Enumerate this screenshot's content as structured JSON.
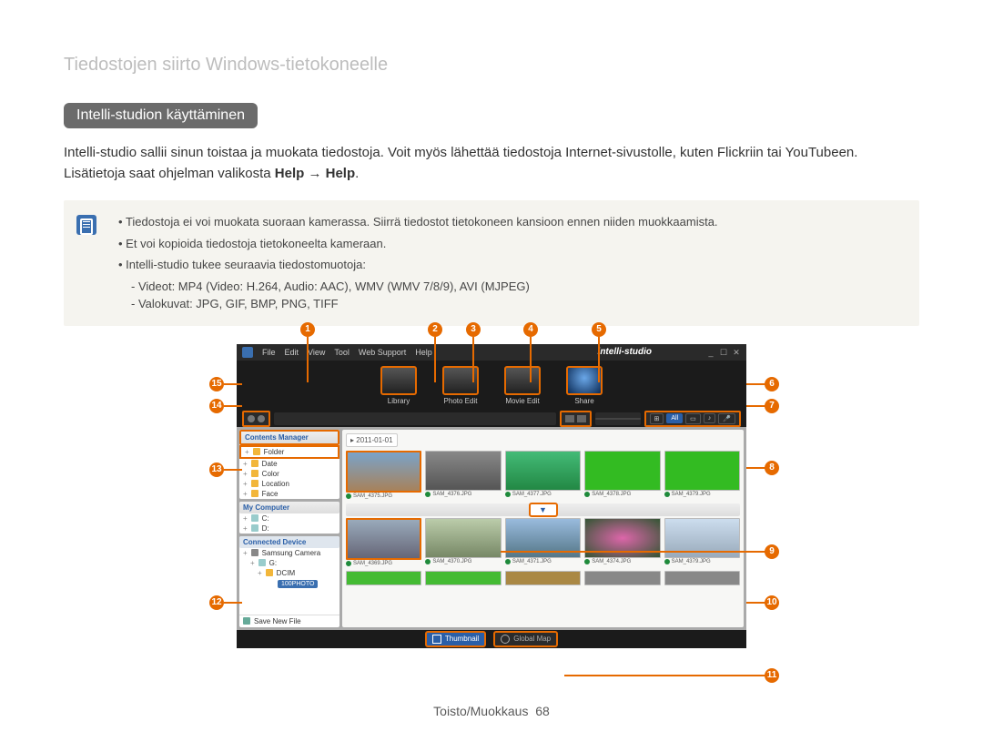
{
  "breadcrumb": "Tiedostojen siirto Windows-tietokoneelle",
  "section_title": "Intelli-studion käyttäminen",
  "intro_html": "Intelli-studio sallii sinun toistaa ja muokata tiedostoja. Voit myös lähettää tiedostoja Internet-sivustolle, kuten Flickriin tai YouTubeen. Lisätietoja saat ohjelman valikosta ",
  "intro_bold": "Help → Help",
  "notes": {
    "li1": "Tiedostoja ei voi muokata suoraan kamerassa. Siirrä tiedostot tietokoneen kansioon ennen niiden muokkaamista.",
    "li2": "Et voi kopioida tiedostoja tietokoneelta kameraan.",
    "li3": "Intelli-studio tukee seuraavia tiedostomuotoja:",
    "sub1": "Videot: MP4 (Video: H.264, Audio: AAC), WMV (WMV 7/8/9), AVI (MJPEG)",
    "sub2": "Valokuvat: JPG, GIF, BMP, PNG, TIFF"
  },
  "app": {
    "brand": "intelli-studio",
    "menus": [
      "File",
      "Edit",
      "View",
      "Tool",
      "Web Support",
      "Help"
    ],
    "window_controls": [
      "minimize",
      "maximize",
      "close"
    ],
    "modes": [
      {
        "name": "library",
        "label": "Library"
      },
      {
        "name": "photo-edit",
        "label": "Photo Edit"
      },
      {
        "name": "movie-edit",
        "label": "Movie Edit"
      },
      {
        "name": "share",
        "label": "Share"
      }
    ],
    "toolbar_right": {
      "filter_all": "All"
    },
    "sidebar": {
      "contents_manager": {
        "title": "Contents Manager",
        "items": [
          "Folder",
          "Date",
          "Color",
          "Location",
          "Face"
        ]
      },
      "my_computer": {
        "title": "My Computer",
        "items": [
          "C:",
          "D:"
        ]
      },
      "connected_device": {
        "title": "Connected Device",
        "root": "Samsung Camera",
        "tree": [
          "G:",
          "DCIM",
          "100PHOTO"
        ]
      },
      "save_new_file": "Save New File"
    },
    "gallery": {
      "date": "2011-01-01",
      "row1": [
        "SAM_4375.JPG",
        "SAM_4376.JPG",
        "SAM_4377.JPG",
        "SAM_4378.JPG",
        "SAM_4379.JPG"
      ],
      "row2": [
        "SAM_4369.JPG",
        "SAM_4370.JPG",
        "SAM_4371.JPG",
        "SAM_4374.JPG",
        "SAM_4379.JPG"
      ]
    },
    "footer": {
      "thumbnail": "Thumbnail",
      "global_map": "Global Map"
    }
  },
  "callouts": {
    "top": {
      "1": "1",
      "2": "2",
      "3": "3",
      "4": "4",
      "5": "5"
    },
    "right": {
      "6": "6",
      "7": "7",
      "8": "8",
      "9": "9",
      "10": "10",
      "11": "11"
    },
    "left": {
      "12": "12",
      "13": "13",
      "14": "14",
      "15": "15"
    }
  },
  "footer": {
    "section": "Toisto/Muokkaus",
    "page": "68"
  },
  "colors": {
    "accent_orange": "#e66a00",
    "accent_blue": "#2a5fa8",
    "pill_bg": "#6b6b6b"
  }
}
